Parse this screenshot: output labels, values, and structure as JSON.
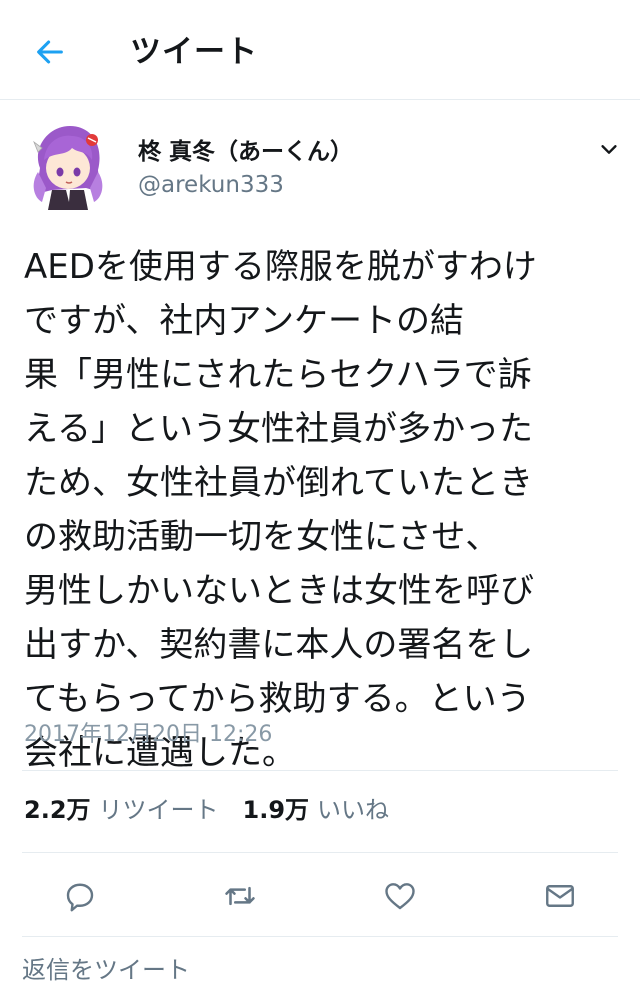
{
  "header": {
    "title": "ツイート",
    "back_icon": "arrow-left-icon"
  },
  "tweet": {
    "display_name": "柊 真冬（あーくん）",
    "username": "@arekun333",
    "text": "AEDを使用する際服を脱がすわけ\nですが、社内アンケートの結\n果「男性にされたらセクハラで訴\nえる」という女性社員が多かった\nため、女性社員が倒れていたとき\nの救助活動一切を女性にさせ、\n男性しかいないときは女性を呼び\n出すか、契約書に本人の署名をし\nてもらってから救助する。という\n会社に遭遇した。",
    "timestamp": "2017年12月20日 12:26"
  },
  "stats": {
    "retweets": "2.2万",
    "retweets_label": "リツイート",
    "likes": "1.9万",
    "likes_label": "いいね"
  },
  "actions": [
    "reply-icon",
    "retweet-icon",
    "like-icon",
    "share-icon"
  ],
  "reply_placeholder": "返信をツイート",
  "colors": {
    "accent": "#1da1f2",
    "secondary_text": "#657786",
    "icon_gray": "#657786",
    "divider": "#e6ecf0"
  }
}
